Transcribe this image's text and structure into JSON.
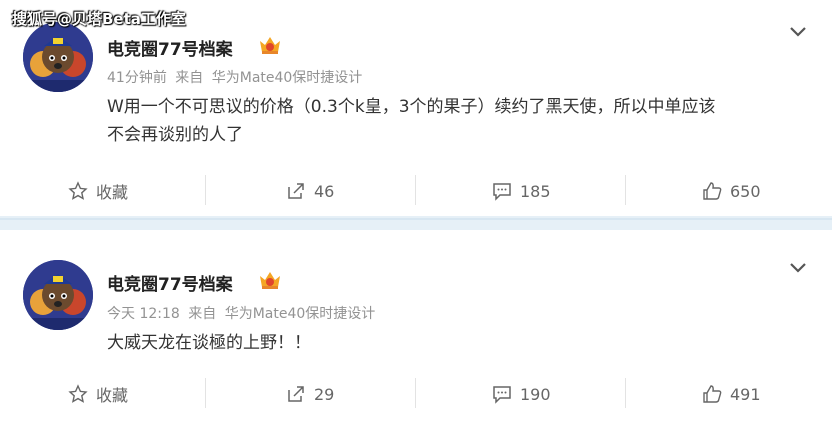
{
  "watermark": "搜狐号@贝塔Beta工作室",
  "posts": [
    {
      "username": "电竞圈77号档案",
      "time": "41分钟前",
      "source_prefix": "来自",
      "source": "华为Mate40保时捷设计",
      "content_lines": [
        "W用一个不可思议的价格（0.3个k皇，3个的果子）续约了黑天使，所以中单应该",
        "不会再谈别的人了"
      ],
      "actions": {
        "favorite": "收藏",
        "repost": "46",
        "comment": "185",
        "like": "650"
      }
    },
    {
      "username": "电竞圈77号档案",
      "time": "今天 12:18",
      "source_prefix": "来自",
      "source": "华为Mate40保时捷设计",
      "content_lines": [
        "大威天龙在谈極的上野！！"
      ],
      "actions": {
        "favorite": "收藏",
        "repost": "29",
        "comment": "190",
        "like": "491"
      }
    }
  ],
  "colors": {
    "divider": "#e6f0f7",
    "meta": "#939393",
    "badge": "#f5a623"
  }
}
